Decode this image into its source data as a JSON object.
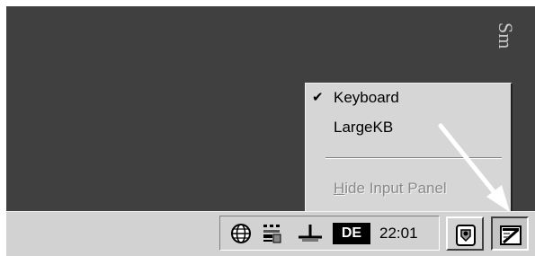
{
  "desktop": {
    "partial_text": "Sm"
  },
  "sip_menu": {
    "items": [
      {
        "label": "Keyboard",
        "checked": true
      },
      {
        "label": "LargeKB",
        "checked": false
      }
    ],
    "hide_item": {
      "label_prefix": "",
      "label_underlined": "H",
      "label_rest": "ide Input Panel",
      "enabled": false
    }
  },
  "taskbar": {
    "tray_icons": [
      "globe-icon",
      "network-icon",
      "connection-icon"
    ],
    "language": "DE",
    "clock": "22:01",
    "buttons": [
      "desktop-switch-icon",
      "input-panel-icon"
    ]
  },
  "colors": {
    "desktop": "#404040",
    "menu_bg": "#d6d6d6",
    "taskbar_bg": "#d2d2d2",
    "arrow": "#ffffff"
  }
}
